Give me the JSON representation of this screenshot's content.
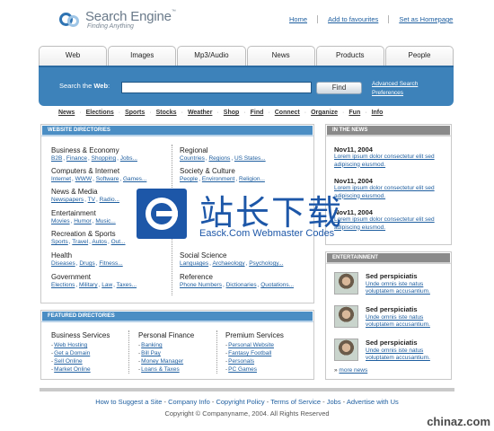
{
  "header": {
    "logo_title": "Search Engine",
    "logo_tm": "™",
    "logo_tagline": "Finding Anything",
    "links": [
      "Home",
      "Add to favourites",
      "Set as Homepage"
    ]
  },
  "tabs": [
    "Web",
    "Images",
    "Mp3/Audio",
    "News",
    "Products",
    "People"
  ],
  "search": {
    "label_prefix": "Search the ",
    "label_bold": "Web",
    "label_suffix": ":",
    "input_value": "",
    "button": "Find",
    "advanced": "Advanced Search",
    "preferences": "Preferences"
  },
  "topics": [
    "News",
    "Elections",
    "Sports",
    "Stocks",
    "Weather",
    "Shop",
    "Find",
    "Connect",
    "Organize",
    "Fun",
    "Info"
  ],
  "directories": {
    "title": "Website Directories",
    "left": [
      {
        "title": "Business & Economy",
        "items": [
          "B2B",
          "Finance",
          "Shopping",
          "Jobs..."
        ]
      },
      {
        "title": "Computers & Internet",
        "items": [
          "Internet",
          "WWW",
          "Software",
          "Games..."
        ]
      },
      {
        "title": "News & Media",
        "items": [
          "Newspapers",
          "TV",
          "Radio..."
        ]
      },
      {
        "title": "Entertainment",
        "items": [
          "Movies",
          "Humor",
          "Music..."
        ]
      },
      {
        "title": "Recreation & Sports",
        "items": [
          "Sports",
          "Travel",
          "Autos",
          "Out..."
        ]
      },
      {
        "title": "Health",
        "items": [
          "Diseases",
          "Drugs",
          "Fitness..."
        ]
      },
      {
        "title": "Government",
        "items": [
          "Elections",
          "Military",
          "Law",
          "Taxes..."
        ]
      }
    ],
    "right": [
      {
        "title": "Regional",
        "items": [
          "Countries",
          "Regions",
          "US States..."
        ]
      },
      {
        "title": "Society & Culture",
        "items": [
          "People",
          "Environment",
          "Religion..."
        ]
      },
      {
        "title": "Social Science",
        "items": [
          "Languages",
          "Archaeology",
          "Psychology..."
        ]
      },
      {
        "title": "Reference",
        "items": [
          "Phone Numbers",
          "Dictionaries",
          "Quotations..."
        ]
      }
    ]
  },
  "news": {
    "title": "In the News",
    "items": [
      {
        "date": "Nov11, 2004",
        "text": "Lorem ipsum dolor consectetur elit sed adipiscing eiusmod."
      },
      {
        "date": "Nov11, 2004",
        "text": "Lorem ipsum dolor consectetur elit sed adipiscing eiusmod."
      },
      {
        "date": "Nov11, 2004",
        "text": "Lorem ipsum dolor consectetur elit sed adipiscing eiusmod."
      }
    ]
  },
  "entertainment": {
    "title": "Entertainment",
    "items": [
      {
        "title": "Sed perspiciatis",
        "text": "Unde omnis iste natus voluptatem accusantium."
      },
      {
        "title": "Sed perspiciatis",
        "text": "Unde omnis iste natus voluptatem accusantium."
      },
      {
        "title": "Sed perspiciatis",
        "text": "Unde omnis iste natus voluptatem accusantium."
      }
    ],
    "more": "more news"
  },
  "featured": {
    "title": "Featured Directories",
    "columns": [
      {
        "title": "Business Services",
        "items": [
          "Web Hosting",
          "Get a Domain",
          "Sell Online",
          "Market Online"
        ]
      },
      {
        "title": "Personal Finance",
        "items": [
          "Banking",
          "Bill Pay",
          "Money Manager",
          "Loans & Taxes"
        ]
      },
      {
        "title": "Premium Services",
        "items": [
          "Personal Website",
          "Fantasy Football",
          "Personals",
          "PC Games"
        ]
      }
    ]
  },
  "footer": {
    "links": [
      "How to Suggest a Site",
      "Company Info",
      "Copyright Policy",
      "Terms of Service",
      "Jobs",
      "Advertise with Us"
    ],
    "copyright": "Copyright © Companyname, 2004. All Rights Reserved"
  },
  "watermark": {
    "cn": "站长下载",
    "en": "Easck.Com Webmaster Codes"
  },
  "brand": "chinaz.com",
  "colors": {
    "accent": "#3d82ba",
    "link": "#1f5fa0",
    "watermark": "#1d57a8"
  }
}
